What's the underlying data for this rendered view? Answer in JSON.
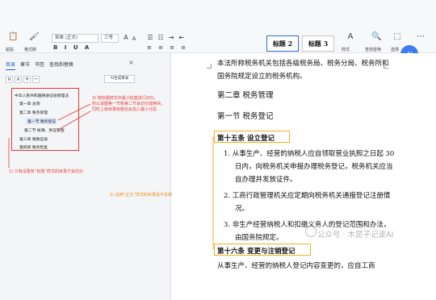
{
  "ribbon": {
    "font_name": "宋体 (正文)",
    "font_size": "三号",
    "format_painter": "格式刷",
    "paste": "粘贴",
    "styles": [
      "标题 2",
      "标题 3"
    ],
    "style_label": "样式",
    "find_replace": "查找替换",
    "select": "选择",
    "format_row": "B I U A",
    "para_row": "≡ ≡ ≡ ≡"
  },
  "nav": {
    "tabs": [
      "目录",
      "章节",
      "书签",
      "查找和替换"
    ],
    "active_tab": "目录",
    "ai_button": "AI生成目录",
    "controls": [
      "∨",
      "∧",
      "+",
      "−"
    ],
    "toc": [
      "中华人民共和国税收征收管理法",
      "第一章 总则",
      "第二章 税务管理",
      "第一节 税务登记",
      "第二节 帐簿、凭证管理",
      "第三章 税款征收",
      "第四章 税务检查"
    ],
    "callout_red_1": "1) 只有设置有“标题”样式的目录才会切分",
    "callout_red_3": "3) 按标题样式中最小粒度进行切分，\n所以说图第一节和第二节会切分成两块，\n同时上级目录标题也会加入最小分段",
    "callout_orange_2": "2) 这种“正文”样式的目录是不会被切分"
  },
  "doc": {
    "lines": [
      "本法所称税务机关包括各级税务局、税务分局、税务所和",
      "国务院规定设立的税务机构。",
      "第二章 税务管理",
      "第一节 税务登记",
      "第十五条 设立登记",
      "1. 从事生产、经营的纳税人应自领取营业执照之日起 30",
      "日内，向税务机关申报办理税务登记，税务机关应当",
      "自办理并发放证件。",
      "2. 工商行政管理机关应定期向税务机关通报登记注册情",
      "况。",
      "3. 非生产经营纳税人和扣缴义务人的登记范围和办法，",
      "由国务院规定。",
      "第十六条 变更与注销登记",
      "从事生产、经营的纳税人登记内容变更的，应自工商"
    ],
    "watermark": "公众号 · 木昆子记录AI"
  },
  "colors": {
    "accent": "#1f5fd6",
    "red": "#e53935",
    "orange": "#ee8f22",
    "highlight": "#f2b21a"
  }
}
